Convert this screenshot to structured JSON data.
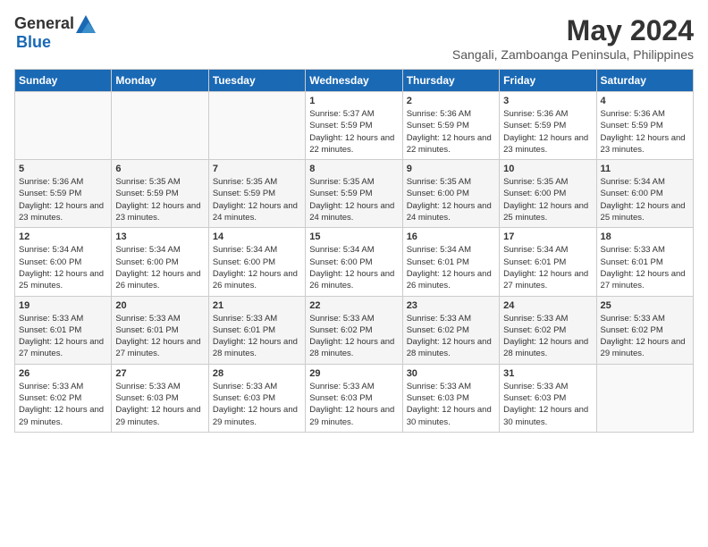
{
  "logo": {
    "general": "General",
    "blue": "Blue"
  },
  "title": {
    "month_year": "May 2024",
    "location": "Sangali, Zamboanga Peninsula, Philippines"
  },
  "days_of_week": [
    "Sunday",
    "Monday",
    "Tuesday",
    "Wednesday",
    "Thursday",
    "Friday",
    "Saturday"
  ],
  "weeks": [
    [
      {
        "day": "",
        "sunrise": "",
        "sunset": "",
        "daylight": ""
      },
      {
        "day": "",
        "sunrise": "",
        "sunset": "",
        "daylight": ""
      },
      {
        "day": "",
        "sunrise": "",
        "sunset": "",
        "daylight": ""
      },
      {
        "day": "1",
        "sunrise": "Sunrise: 5:37 AM",
        "sunset": "Sunset: 5:59 PM",
        "daylight": "Daylight: 12 hours and 22 minutes."
      },
      {
        "day": "2",
        "sunrise": "Sunrise: 5:36 AM",
        "sunset": "Sunset: 5:59 PM",
        "daylight": "Daylight: 12 hours and 22 minutes."
      },
      {
        "day": "3",
        "sunrise": "Sunrise: 5:36 AM",
        "sunset": "Sunset: 5:59 PM",
        "daylight": "Daylight: 12 hours and 23 minutes."
      },
      {
        "day": "4",
        "sunrise": "Sunrise: 5:36 AM",
        "sunset": "Sunset: 5:59 PM",
        "daylight": "Daylight: 12 hours and 23 minutes."
      }
    ],
    [
      {
        "day": "5",
        "sunrise": "Sunrise: 5:36 AM",
        "sunset": "Sunset: 5:59 PM",
        "daylight": "Daylight: 12 hours and 23 minutes."
      },
      {
        "day": "6",
        "sunrise": "Sunrise: 5:35 AM",
        "sunset": "Sunset: 5:59 PM",
        "daylight": "Daylight: 12 hours and 23 minutes."
      },
      {
        "day": "7",
        "sunrise": "Sunrise: 5:35 AM",
        "sunset": "Sunset: 5:59 PM",
        "daylight": "Daylight: 12 hours and 24 minutes."
      },
      {
        "day": "8",
        "sunrise": "Sunrise: 5:35 AM",
        "sunset": "Sunset: 5:59 PM",
        "daylight": "Daylight: 12 hours and 24 minutes."
      },
      {
        "day": "9",
        "sunrise": "Sunrise: 5:35 AM",
        "sunset": "Sunset: 6:00 PM",
        "daylight": "Daylight: 12 hours and 24 minutes."
      },
      {
        "day": "10",
        "sunrise": "Sunrise: 5:35 AM",
        "sunset": "Sunset: 6:00 PM",
        "daylight": "Daylight: 12 hours and 25 minutes."
      },
      {
        "day": "11",
        "sunrise": "Sunrise: 5:34 AM",
        "sunset": "Sunset: 6:00 PM",
        "daylight": "Daylight: 12 hours and 25 minutes."
      }
    ],
    [
      {
        "day": "12",
        "sunrise": "Sunrise: 5:34 AM",
        "sunset": "Sunset: 6:00 PM",
        "daylight": "Daylight: 12 hours and 25 minutes."
      },
      {
        "day": "13",
        "sunrise": "Sunrise: 5:34 AM",
        "sunset": "Sunset: 6:00 PM",
        "daylight": "Daylight: 12 hours and 26 minutes."
      },
      {
        "day": "14",
        "sunrise": "Sunrise: 5:34 AM",
        "sunset": "Sunset: 6:00 PM",
        "daylight": "Daylight: 12 hours and 26 minutes."
      },
      {
        "day": "15",
        "sunrise": "Sunrise: 5:34 AM",
        "sunset": "Sunset: 6:00 PM",
        "daylight": "Daylight: 12 hours and 26 minutes."
      },
      {
        "day": "16",
        "sunrise": "Sunrise: 5:34 AM",
        "sunset": "Sunset: 6:01 PM",
        "daylight": "Daylight: 12 hours and 26 minutes."
      },
      {
        "day": "17",
        "sunrise": "Sunrise: 5:34 AM",
        "sunset": "Sunset: 6:01 PM",
        "daylight": "Daylight: 12 hours and 27 minutes."
      },
      {
        "day": "18",
        "sunrise": "Sunrise: 5:33 AM",
        "sunset": "Sunset: 6:01 PM",
        "daylight": "Daylight: 12 hours and 27 minutes."
      }
    ],
    [
      {
        "day": "19",
        "sunrise": "Sunrise: 5:33 AM",
        "sunset": "Sunset: 6:01 PM",
        "daylight": "Daylight: 12 hours and 27 minutes."
      },
      {
        "day": "20",
        "sunrise": "Sunrise: 5:33 AM",
        "sunset": "Sunset: 6:01 PM",
        "daylight": "Daylight: 12 hours and 27 minutes."
      },
      {
        "day": "21",
        "sunrise": "Sunrise: 5:33 AM",
        "sunset": "Sunset: 6:01 PM",
        "daylight": "Daylight: 12 hours and 28 minutes."
      },
      {
        "day": "22",
        "sunrise": "Sunrise: 5:33 AM",
        "sunset": "Sunset: 6:02 PM",
        "daylight": "Daylight: 12 hours and 28 minutes."
      },
      {
        "day": "23",
        "sunrise": "Sunrise: 5:33 AM",
        "sunset": "Sunset: 6:02 PM",
        "daylight": "Daylight: 12 hours and 28 minutes."
      },
      {
        "day": "24",
        "sunrise": "Sunrise: 5:33 AM",
        "sunset": "Sunset: 6:02 PM",
        "daylight": "Daylight: 12 hours and 28 minutes."
      },
      {
        "day": "25",
        "sunrise": "Sunrise: 5:33 AM",
        "sunset": "Sunset: 6:02 PM",
        "daylight": "Daylight: 12 hours and 29 minutes."
      }
    ],
    [
      {
        "day": "26",
        "sunrise": "Sunrise: 5:33 AM",
        "sunset": "Sunset: 6:02 PM",
        "daylight": "Daylight: 12 hours and 29 minutes."
      },
      {
        "day": "27",
        "sunrise": "Sunrise: 5:33 AM",
        "sunset": "Sunset: 6:03 PM",
        "daylight": "Daylight: 12 hours and 29 minutes."
      },
      {
        "day": "28",
        "sunrise": "Sunrise: 5:33 AM",
        "sunset": "Sunset: 6:03 PM",
        "daylight": "Daylight: 12 hours and 29 minutes."
      },
      {
        "day": "29",
        "sunrise": "Sunrise: 5:33 AM",
        "sunset": "Sunset: 6:03 PM",
        "daylight": "Daylight: 12 hours and 29 minutes."
      },
      {
        "day": "30",
        "sunrise": "Sunrise: 5:33 AM",
        "sunset": "Sunset: 6:03 PM",
        "daylight": "Daylight: 12 hours and 30 minutes."
      },
      {
        "day": "31",
        "sunrise": "Sunrise: 5:33 AM",
        "sunset": "Sunset: 6:03 PM",
        "daylight": "Daylight: 12 hours and 30 minutes."
      },
      {
        "day": "",
        "sunrise": "",
        "sunset": "",
        "daylight": ""
      }
    ]
  ]
}
